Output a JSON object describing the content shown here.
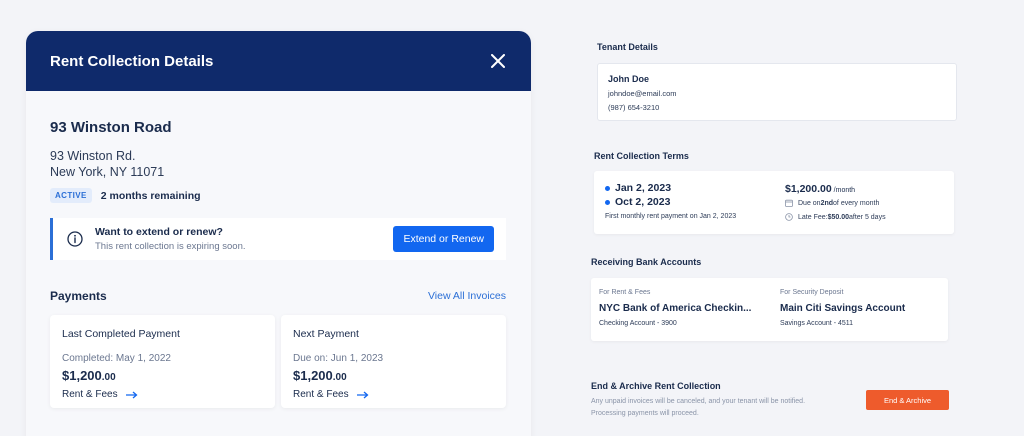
{
  "panel": {
    "title": "Rent Collection Details",
    "address_title": "93 Winston Road",
    "address_line1": "93 Winston Rd.",
    "address_line2": "New York, NY 11071",
    "status": "ACTIVE",
    "remaining": "2 months remaining",
    "notice": {
      "title": "Want to extend or renew?",
      "subtitle": "This rent collection is expiring soon.",
      "button": "Extend or Renew"
    },
    "payments": {
      "title": "Payments",
      "view_all": "View All Invoices",
      "last": {
        "title": "Last Completed Payment",
        "date": "Completed: May 1, 2022",
        "amount": "$1,200",
        "cents": ".00",
        "link": "Rent & Fees"
      },
      "next": {
        "title": "Next Payment",
        "date": "Due on: Jun 1, 2023",
        "amount": "$1,200",
        "cents": ".00",
        "link": "Rent & Fees"
      }
    }
  },
  "tenant": {
    "section": "Tenant Details",
    "name": "John Doe",
    "email": "johndoe@email.com",
    "phone": "(987) 654-3210"
  },
  "terms": {
    "section": "Rent Collection Terms",
    "start": "Jan 2, 2023",
    "end": "Oct 2, 2023",
    "note": "First monthly rent payment on Jan 2, 2023",
    "amount": "$1,200.00",
    "per": " /month",
    "due_prefix": "Due on ",
    "due_day": "2nd",
    "due_suffix": " of every month",
    "late_prefix": "Late Fee: ",
    "late_amount": "$50.00",
    "late_suffix": " after 5 days"
  },
  "banks": {
    "section": "Receiving Bank Accounts",
    "rent": {
      "label": "For Rent & Fees",
      "name": "NYC Bank of America Checkin...",
      "sub": "Checking Account - 3900"
    },
    "deposit": {
      "label": "For Security Deposit",
      "name": "Main Citi Savings Account",
      "sub": "Savings Account - 4511"
    }
  },
  "archive": {
    "title": "End & Archive Rent Collection",
    "desc1": "Any unpaid invoices will be canceled, and your tenant will be notified.",
    "desc2": "Processing payments will proceed.",
    "button": "End & Archive"
  },
  "colors": {
    "header": "#0f2a6b",
    "accent": "#1267f0",
    "danger": "#ee5b2c"
  }
}
